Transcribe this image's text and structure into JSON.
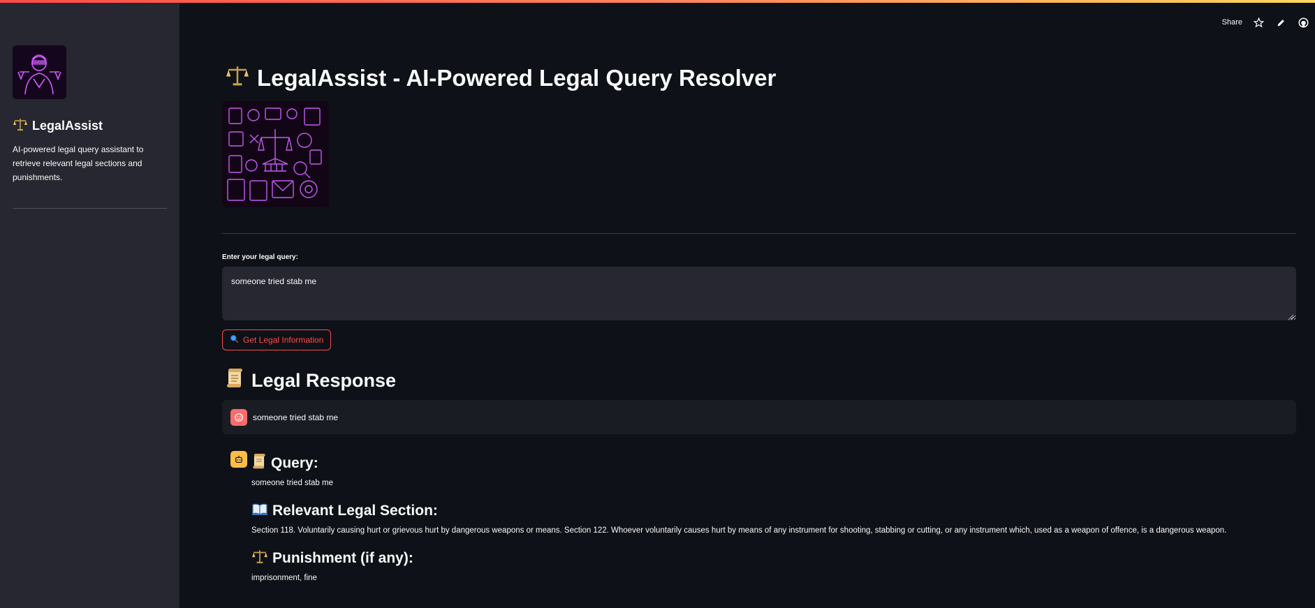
{
  "header": {
    "share_label": "Share"
  },
  "sidebar": {
    "title": "LegalAssist",
    "description": "AI-powered legal query assistant to retrieve relevant legal sections and punishments."
  },
  "main": {
    "title": "LegalAssist - AI-Powered Legal Query Resolver",
    "query_label": "Enter your legal query:",
    "query_value": "someone tried stab me",
    "button_label": "Get Legal Information",
    "response_heading": "Legal Response",
    "user_message": "someone tried stab me",
    "bot": {
      "query_heading": "Query:",
      "query_text": "someone tried stab me",
      "section_heading": "Relevant Legal Section:",
      "section_text": "Section 118. Voluntarily causing hurt or grievous hurt by dangerous weapons or means. Section 122. Whoever voluntarily causes hurt by means of any instrument for shooting, stabbing or cutting, or any instrument which, used as a weapon of offence, is a dangerous weapon.",
      "punishment_heading": "Punishment (if any):",
      "punishment_text": "imprisonment, fine"
    }
  },
  "icons": {
    "scales": "scales-icon",
    "scroll": "scroll-icon",
    "book": "open-book-icon",
    "search": "magnifier-icon",
    "star": "star-icon",
    "edit": "pencil-icon",
    "github": "github-icon"
  },
  "colors": {
    "background": "#0e1117",
    "sidebar": "#262730",
    "accent": "#ff4b4b",
    "user_avatar": "#ff6b6b",
    "bot_avatar": "#ffbd45"
  }
}
